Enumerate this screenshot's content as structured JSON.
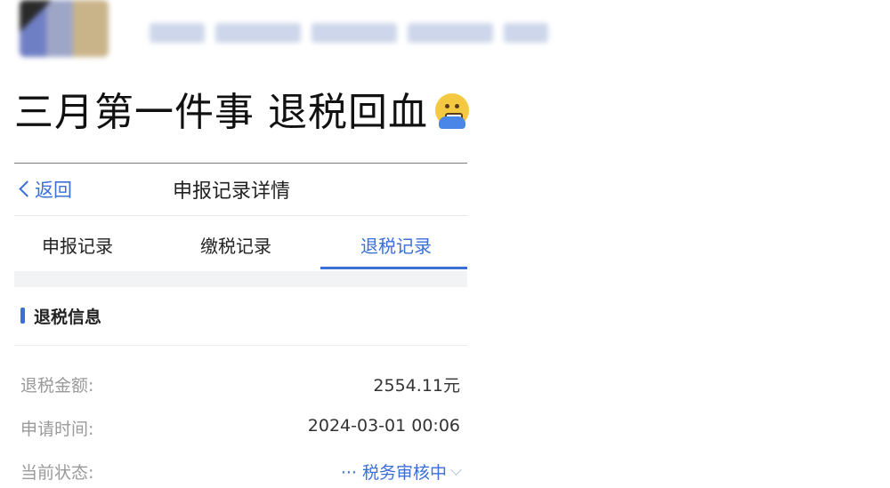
{
  "post": {
    "title": "三月第一件事 退税回血",
    "emoji": "grimacing-face-emoji"
  },
  "screen": {
    "nav": {
      "back_label": "返回",
      "title": "申报记录详情"
    },
    "tabs": [
      {
        "label": "申报记录",
        "active": false
      },
      {
        "label": "缴税记录",
        "active": false
      },
      {
        "label": "退税记录",
        "active": true
      }
    ],
    "section": {
      "title": "退税信息"
    },
    "rows": [
      {
        "label": "退税金额:",
        "value": "2554.11元"
      },
      {
        "label": "申请时间:",
        "value": "2024-03-01 00:06"
      },
      {
        "label": "当前状态:",
        "value": "··· 税务审核中"
      }
    ]
  },
  "colors": {
    "accent": "#3b6fd8",
    "label_gray": "#9a9a9a",
    "divider": "#ececec",
    "background_gap": "#f2f3f5"
  }
}
